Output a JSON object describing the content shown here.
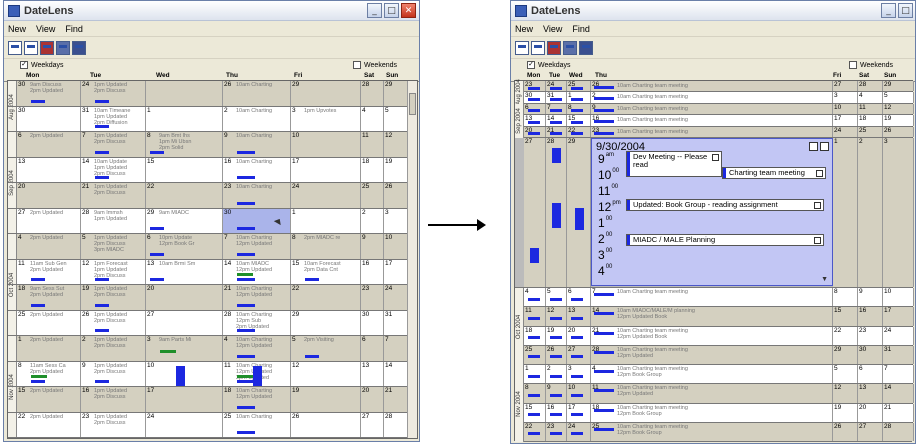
{
  "app": {
    "title": "DateLens"
  },
  "menu": [
    "New",
    "View",
    "Find"
  ],
  "window_buttons": {
    "minimize": "_",
    "maximize": "□",
    "close": "✕"
  },
  "left": {
    "weekdays_label": "Weekdays",
    "weekends_label": "Weekends",
    "days": [
      "Mon",
      "Tue",
      "Wed",
      "Thu",
      "Fri",
      "Sat",
      "Sun"
    ],
    "months": [
      "Aug 2004",
      "Sep 2004",
      "Oct 2004",
      "Nov 2004"
    ],
    "rows": [
      {
        "shade": true,
        "cells": [
          {
            "n": "30",
            "t": "9am Discuss\n2pm Updated"
          },
          {
            "n": "24",
            "t": "1pm Updated\n2pm Discuss"
          },
          {
            "n": "",
            "t": ""
          },
          {
            "n": "26",
            "t": "10am Charting"
          },
          {
            "n": "29",
            "t": ""
          },
          {
            "n": "28",
            "t": ""
          },
          {
            "n": "29",
            "t": ""
          }
        ]
      },
      {
        "shade": false,
        "cells": [
          {
            "n": "30",
            "t": ""
          },
          {
            "n": "31",
            "t": "10am Timeane\n1pm Updated\n2pm Diffusion"
          },
          {
            "n": "1",
            "t": ""
          },
          {
            "n": "2",
            "t": "10am Charting"
          },
          {
            "n": "3",
            "t": "1pm Upvotes"
          },
          {
            "n": "4",
            "t": ""
          },
          {
            "n": "5",
            "t": ""
          }
        ]
      },
      {
        "shade": true,
        "cells": [
          {
            "n": "6",
            "t": "2pm Updated"
          },
          {
            "n": "7",
            "t": "1pm Updated\n2pm Discuss"
          },
          {
            "n": "8",
            "t": "9am Bmt Ihs\n1pm Mi Ubsn\n2pm Solid"
          },
          {
            "n": "9",
            "t": "10am Charting"
          },
          {
            "n": "10",
            "t": ""
          },
          {
            "n": "11",
            "t": ""
          },
          {
            "n": "12",
            "t": ""
          }
        ]
      },
      {
        "shade": false,
        "cells": [
          {
            "n": "13",
            "t": ""
          },
          {
            "n": "14",
            "t": "10am Update\n1pm Updated\n2pm Discuss"
          },
          {
            "n": "15",
            "t": ""
          },
          {
            "n": "16",
            "t": "10am Charting"
          },
          {
            "n": "17",
            "t": ""
          },
          {
            "n": "18",
            "t": ""
          },
          {
            "n": "19",
            "t": ""
          }
        ]
      },
      {
        "shade": true,
        "cells": [
          {
            "n": "20",
            "t": ""
          },
          {
            "n": "21",
            "t": "1pm Updated\n2pm Discuss"
          },
          {
            "n": "22",
            "t": ""
          },
          {
            "n": "23",
            "t": "10am Charting"
          },
          {
            "n": "24",
            "t": ""
          },
          {
            "n": "25",
            "t": ""
          },
          {
            "n": "26",
            "t": ""
          }
        ]
      },
      {
        "shade": false,
        "cells": [
          {
            "n": "27",
            "t": "2pm Updated"
          },
          {
            "n": "28",
            "t": "9am Immsh\n1pm Updated"
          },
          {
            "n": "29",
            "t": "9am MIADC"
          },
          {
            "n": "30",
            "t": ""
          },
          {
            "n": "1",
            "t": ""
          },
          {
            "n": "2",
            "t": ""
          },
          {
            "n": "3",
            "t": ""
          }
        ]
      },
      {
        "shade": true,
        "cells": [
          {
            "n": "4",
            "t": "2pm Updated"
          },
          {
            "n": "5",
            "t": "1pm Updated\n2pm Discuss\n3pm MIADC"
          },
          {
            "n": "6",
            "t": "10pm Update\n12pm Book Gr"
          },
          {
            "n": "7",
            "t": "10am Charting\n12pm Updated"
          },
          {
            "n": "8",
            "t": "2pm MIADC re"
          },
          {
            "n": "9",
            "t": ""
          },
          {
            "n": "10",
            "t": ""
          }
        ]
      },
      {
        "shade": false,
        "cells": [
          {
            "n": "11",
            "t": "11am Sub Gen\n2pm Updated"
          },
          {
            "n": "12",
            "t": "1pm Forecast\n1pm Updated\n2pm Discuss"
          },
          {
            "n": "13",
            "t": "10am Brmi Sm"
          },
          {
            "n": "14",
            "t": "10am MIADC\n12pm Updated"
          },
          {
            "n": "15",
            "t": "10am Forecast\n2pm Data Cnt"
          },
          {
            "n": "16",
            "t": ""
          },
          {
            "n": "17",
            "t": ""
          }
        ]
      },
      {
        "shade": true,
        "cells": [
          {
            "n": "18",
            "t": "9am Sess Sut\n2pm Updated"
          },
          {
            "n": "19",
            "t": "1pm Updated\n2pm Discuss"
          },
          {
            "n": "20",
            "t": ""
          },
          {
            "n": "21",
            "t": "10am Charting\n12pm Updated"
          },
          {
            "n": "22",
            "t": ""
          },
          {
            "n": "23",
            "t": ""
          },
          {
            "n": "24",
            "t": ""
          }
        ]
      },
      {
        "shade": false,
        "cells": [
          {
            "n": "25",
            "t": "2pm Updated"
          },
          {
            "n": "26",
            "t": "1pm Updated\n2pm Discuss"
          },
          {
            "n": "27",
            "t": ""
          },
          {
            "n": "28",
            "t": "10am Charting\n12pm Sub\n2pm Updated"
          },
          {
            "n": "29",
            "t": ""
          },
          {
            "n": "30",
            "t": ""
          },
          {
            "n": "31",
            "t": ""
          }
        ]
      },
      {
        "shade": true,
        "cells": [
          {
            "n": "1",
            "t": "2pm Updated"
          },
          {
            "n": "2",
            "t": "1pm Updated\n2pm Discuss"
          },
          {
            "n": "3",
            "t": "9am Parts Mi"
          },
          {
            "n": "4",
            "t": "10am Charting\n12pm Updated"
          },
          {
            "n": "5",
            "t": "2pm Visiting"
          },
          {
            "n": "6",
            "t": ""
          },
          {
            "n": "7",
            "t": ""
          }
        ]
      },
      {
        "shade": false,
        "cells": [
          {
            "n": "8",
            "t": "11am Sess Ca\n2pm Updated"
          },
          {
            "n": "9",
            "t": "1pm Updated\n2pm Discuss"
          },
          {
            "n": "10",
            "t": ""
          },
          {
            "n": "11",
            "t": "10am Charting\n12pm Updated\n2pm Updated"
          },
          {
            "n": "12",
            "t": ""
          },
          {
            "n": "13",
            "t": ""
          },
          {
            "n": "14",
            "t": ""
          }
        ]
      },
      {
        "shade": true,
        "cells": [
          {
            "n": "15",
            "t": "2pm Updated"
          },
          {
            "n": "16",
            "t": "1pm Updated\n2pm Discuss"
          },
          {
            "n": "17",
            "t": ""
          },
          {
            "n": "18",
            "t": "10am Charting\n12pm Updated"
          },
          {
            "n": "19",
            "t": ""
          },
          {
            "n": "20",
            "t": ""
          },
          {
            "n": "21",
            "t": ""
          }
        ]
      },
      {
        "shade": false,
        "cells": [
          {
            "n": "22",
            "t": "2pm Updated"
          },
          {
            "n": "23",
            "t": "1pm Updated\n2pm Discuss"
          },
          {
            "n": "24",
            "t": ""
          },
          {
            "n": "25",
            "t": "10am Charting"
          },
          {
            "n": "26",
            "t": ""
          },
          {
            "n": "27",
            "t": ""
          },
          {
            "n": "28",
            "t": ""
          }
        ]
      }
    ]
  },
  "right": {
    "weekdays_label": "Weekdays",
    "weekends_label": "Weekends",
    "days": [
      "Mon",
      "Tue",
      "Wed",
      "Thu",
      "Fri",
      "Sat",
      "Sun"
    ],
    "months": [
      "Aug 2004",
      "Sep 2004",
      "Oct 2004",
      "Nov 2004"
    ],
    "top_rows": [
      {
        "shade": true,
        "n": [
          "23",
          "24",
          "25",
          "26",
          "27",
          "28",
          "29"
        ]
      },
      {
        "shade": false,
        "n": [
          "30",
          "31",
          "1",
          "2",
          "3",
          "4",
          "5"
        ]
      },
      {
        "shade": true,
        "n": [
          "6",
          "7",
          "8",
          "9",
          "10",
          "11",
          "12"
        ]
      },
      {
        "shade": false,
        "n": [
          "13",
          "14",
          "15",
          "16",
          "17",
          "18",
          "19"
        ]
      },
      {
        "shade": true,
        "n": [
          "20",
          "21",
          "22",
          "23",
          "24",
          "25",
          "26"
        ]
      }
    ],
    "focus_row": {
      "n": [
        "27",
        "28",
        "29",
        "",
        "",
        "1",
        "2",
        "3"
      ]
    },
    "bottom_rows": [
      {
        "shade": false,
        "n": [
          "4",
          "5",
          "6",
          "7",
          "8",
          "9",
          "10"
        ]
      },
      {
        "shade": true,
        "n": [
          "11",
          "12",
          "13",
          "14",
          "15",
          "16",
          "17"
        ]
      },
      {
        "shade": false,
        "n": [
          "18",
          "19",
          "20",
          "21",
          "22",
          "23",
          "24"
        ]
      },
      {
        "shade": true,
        "n": [
          "25",
          "26",
          "27",
          "28",
          "29",
          "30",
          "31"
        ]
      },
      {
        "shade": false,
        "n": [
          "1",
          "2",
          "3",
          "4",
          "5",
          "6",
          "7"
        ]
      },
      {
        "shade": true,
        "n": [
          "8",
          "9",
          "10",
          "11",
          "12",
          "13",
          "14"
        ]
      },
      {
        "shade": false,
        "n": [
          "15",
          "16",
          "17",
          "18",
          "19",
          "20",
          "21"
        ]
      },
      {
        "shade": true,
        "n": [
          "22",
          "23",
          "24",
          "25",
          "26",
          "27",
          "28"
        ]
      }
    ],
    "thu_events": [
      "10am Charting team meeting",
      "10am Charting team meeting",
      "10am Charting team meeting",
      "10am Charting team meeting",
      "10am Charting team meeting"
    ],
    "thu_events_bottom": [
      "10am Charting team meeting",
      "10am MIADC/MALE/M planning\n12pm Updated Book",
      "10am Charting team meeting\n12pm Updated Book",
      "10am Charting team meeting\n12pm Updated",
      "10am Charting team meeting\n12pm Book Group",
      "10am Charting team meeting\n12pm Updated",
      "10am Charting team meeting\n12pm Book Group",
      "10am Charting team meeting\n12pm Book Group"
    ],
    "popup": {
      "date": "9/30/2004",
      "hours": [
        {
          "h": "9",
          "s": "am"
        },
        {
          "h": "10",
          "s": "00"
        },
        {
          "h": "11",
          "s": "00"
        },
        {
          "h": "12",
          "s": "pm"
        },
        {
          "h": "1",
          "s": "00"
        },
        {
          "h": "2",
          "s": "00"
        },
        {
          "h": "3",
          "s": "00"
        },
        {
          "h": "4",
          "s": "00"
        }
      ],
      "appointments": [
        {
          "text": "Dev Meeting -- Please read"
        },
        {
          "text": "Charting team meeting"
        },
        {
          "text": "Updated: Book Group - reading assignment"
        },
        {
          "text": "MIADC / MALE Planning"
        }
      ]
    }
  },
  "colors": {
    "accent": "#1c28e0",
    "green": "#1f8f2a",
    "highlight": "#aab4ea",
    "popup": "#c2c6f4",
    "shade": "#d4d0c0"
  }
}
